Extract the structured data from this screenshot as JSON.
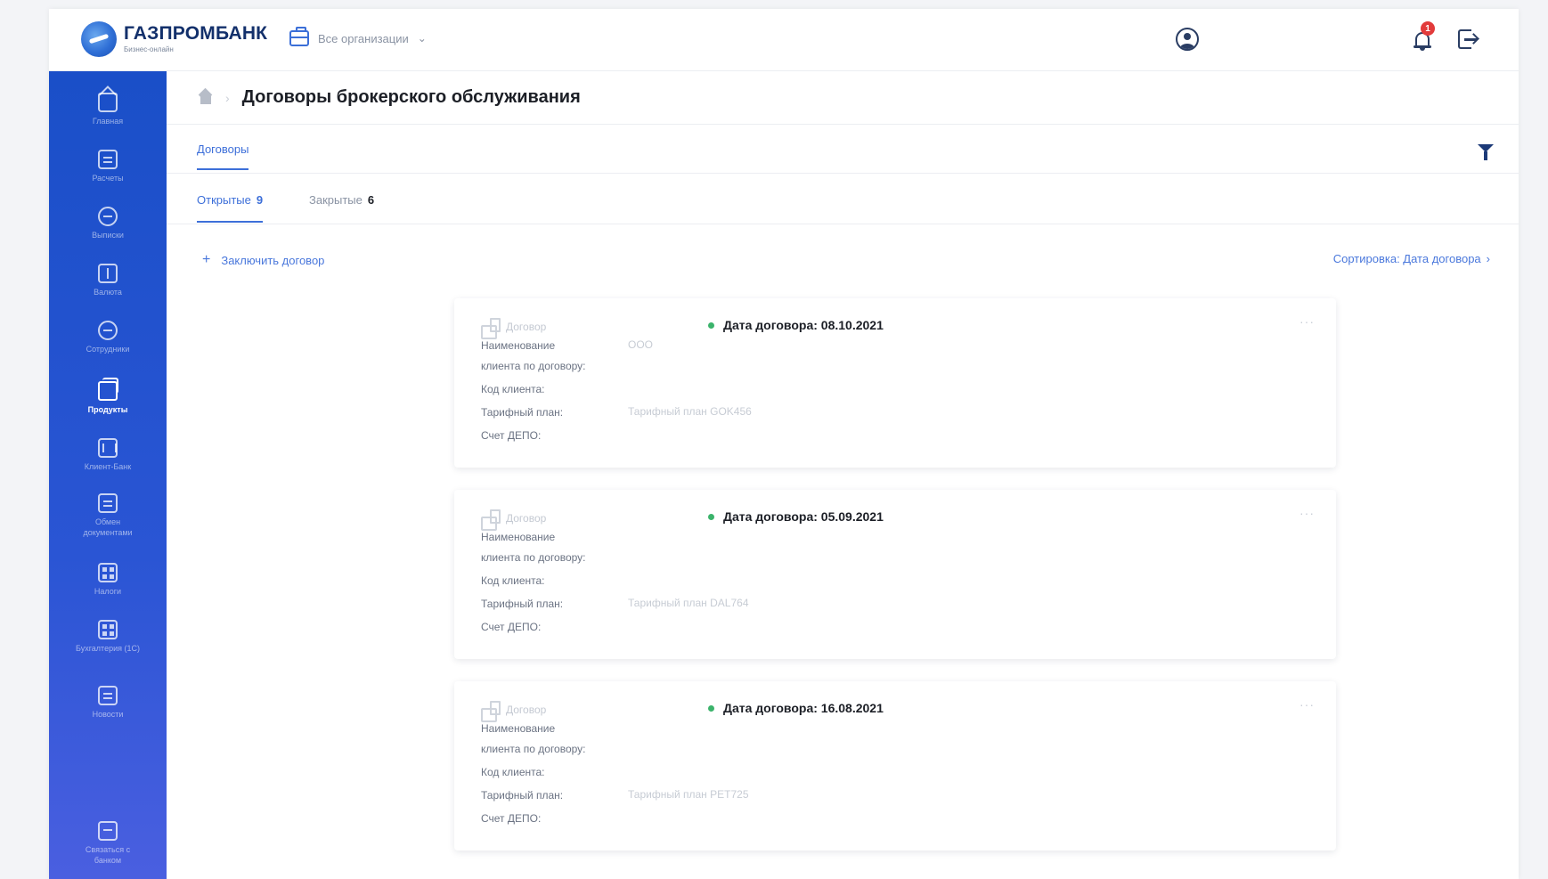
{
  "header": {
    "logo_name": "ГАЗПРОМБАНК",
    "logo_sub": "Бизнес-онлайн",
    "org_selector": "Все организации",
    "user_name": ""
  },
  "notifications": {
    "count": "1"
  },
  "sidebar": {
    "items": [
      {
        "label": "Главная",
        "icon": "home-icon"
      },
      {
        "label": "Расчеты",
        "icon": "payments-icon"
      },
      {
        "label": "Выписки",
        "icon": "statements-icon"
      },
      {
        "label": "Валюта",
        "icon": "currency-icon"
      },
      {
        "label": "Сотрудники",
        "icon": "employees-icon"
      },
      {
        "label": "Продукты",
        "icon": "products-icon"
      },
      {
        "label": "Клиент-Банк",
        "icon": "bank-icon"
      },
      {
        "label": "Обмен документами",
        "icon": "exchange-icon"
      },
      {
        "label": "Налоги",
        "icon": "taxes-icon"
      },
      {
        "label": "Бухгалтерия (1С)",
        "icon": "accounting-icon"
      },
      {
        "label": "Новости",
        "icon": "news-icon"
      },
      {
        "label": "Связаться с банком",
        "icon": "chat-icon"
      }
    ]
  },
  "breadcrumb": {
    "title": "Договоры брокерского обслуживания"
  },
  "section_tab": "Договоры",
  "status_tabs": [
    {
      "label": "Открытые",
      "count": "9"
    },
    {
      "label": "Закрытые",
      "count": "6"
    }
  ],
  "actions": {
    "add_contract": "Заключить договор",
    "sort": "Сортировка: Дата договора"
  },
  "contract_labels": {
    "type": "Договор",
    "client_name_line1": "Наименование",
    "client_name_line2": "клиента по договору:",
    "client_code": "Код клиента:",
    "tariff": "Тарифный план:",
    "depo": "Счет ДЕПО:"
  },
  "contracts": [
    {
      "date": "Дата договора: 08.10.2021",
      "client_name": "ООО",
      "tariff": "Тарифный план GOK456",
      "more": "···"
    },
    {
      "date": "Дата договора: 05.09.2021",
      "client_name": "",
      "tariff": "Тарифный план DAL764",
      "more": "···"
    },
    {
      "date": "Дата договора: 16.08.2021",
      "client_name": "",
      "tariff": "Тарифный план PET725",
      "more": "···"
    }
  ],
  "colors": {
    "accent": "#3d6fd9",
    "sidebar": "#1a4fc8",
    "status_active": "#3bb36b",
    "badge": "#e23b3b"
  }
}
